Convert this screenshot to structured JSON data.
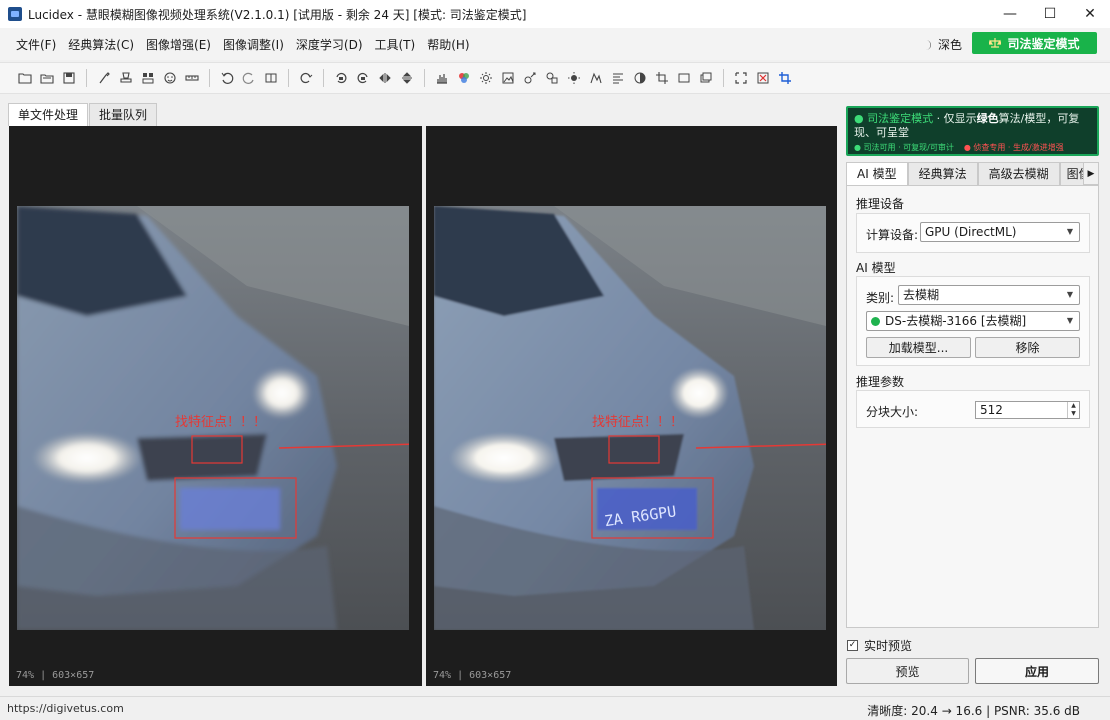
{
  "window": {
    "title": "Lucidex - 慧眼模糊图像视频处理系统(V2.1.0.1)  [试用版 - 剩余 24 天]  [模式: 司法鉴定模式]",
    "minimize": "—",
    "maximize": "☐",
    "close": "✕"
  },
  "menu": {
    "items": [
      "文件(F)",
      "经典算法(C)",
      "图像增强(E)",
      "图像调整(I)",
      "深度学习(D)",
      "工具(T)",
      "帮助(H)"
    ],
    "theme_label": "深色",
    "forensic_button": "司法鉴定模式"
  },
  "toolbar": {
    "icons": [
      "open-folder-icon",
      "open-file-icon",
      "save-icon",
      "brush-icon",
      "stamp-icon",
      "grid-icon",
      "face-icon",
      "ruler-icon",
      "undo-icon",
      "redo-icon",
      "compare-icon",
      "refresh-icon",
      "rotate-left-icon",
      "rotate-right-icon",
      "flip-horizontal-icon",
      "flip-vertical-icon",
      "histogram-icon",
      "color-icon",
      "brightness-icon",
      "image-icon",
      "transform-icon",
      "shapes-icon",
      "sun-icon",
      "levels-icon",
      "align-icon",
      "contrast-icon",
      "crop-icon",
      "frame-icon",
      "layers-icon",
      "select-icon",
      "clear-selection-icon",
      "crop-active-icon"
    ]
  },
  "left_tabs": {
    "single": "单文件处理",
    "batch": "批量队列"
  },
  "panes": {
    "left": {
      "zoom": "74%  |  603×657",
      "annotation": "找特征点！！！",
      "plate_text": ""
    },
    "right": {
      "zoom": "74%  |  603×657",
      "annotation": "找特征点！！！",
      "plate_text": "ZA R6GPU"
    }
  },
  "forensic_banner": {
    "mode": "● 司法鉴定模式",
    "sep": " · ",
    "desc_a": "仅显示",
    "desc_b": "绿色",
    "desc_c": "算法/模型，可复现、可呈堂",
    "note_green": "● 司法可用 · 可复现/可审计",
    "note_red": "● 侦查专用 · 生成/激进增强"
  },
  "right_tabs": [
    "AI 模型",
    "经典算法",
    "高级去模糊",
    "图像"
  ],
  "ai_panel": {
    "device_section": "推理设备",
    "device_label": "计算设备:",
    "device_value": "GPU (DirectML)",
    "model_section": "AI 模型",
    "category_label": "类别:",
    "category_value": "去模糊",
    "model_value": "DS-去模糊-3166 [去模糊]",
    "load_button": "加载模型...",
    "remove_button": "移除",
    "params_section": "推理参数",
    "tile_label": "分块大小:",
    "tile_value": "512"
  },
  "footer_controls": {
    "live_preview": "实时预览",
    "live_checked": "✓",
    "preview_button": "预览",
    "apply_button": "应用"
  },
  "status": {
    "url": "https://digivetus.com",
    "metrics": "清晰度: 20.4 → 16.6  |  PSNR: 35.6 dB"
  },
  "colors": {
    "accent_green": "#19b34a",
    "banner_bg": "#0f3f2b",
    "annotation_red": "#e53935"
  }
}
